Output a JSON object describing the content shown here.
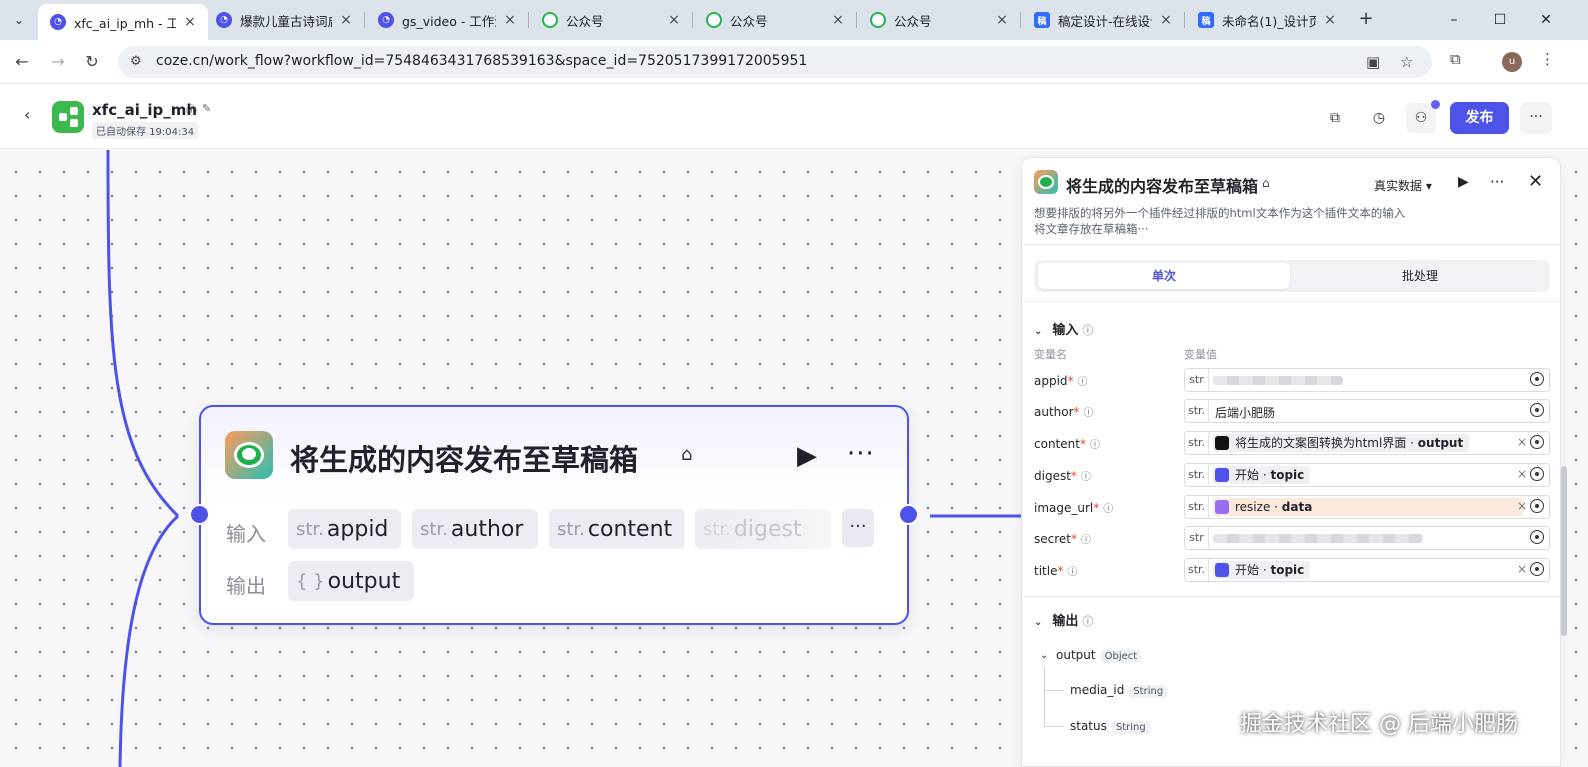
{
  "browser": {
    "tabs": [
      {
        "label": "xfc_ai_ip_mh - 工",
        "icon": "coze-icon",
        "active": true
      },
      {
        "label": "爆款儿童古诗词启",
        "icon": "coze-icon"
      },
      {
        "label": "gs_video - 工作流",
        "icon": "coze-icon"
      },
      {
        "label": "公众号",
        "icon": "wechat-icon"
      },
      {
        "label": "公众号",
        "icon": "wechat-icon"
      },
      {
        "label": "公众号",
        "icon": "wechat-icon"
      },
      {
        "label": "稿定设计-在线设计",
        "icon": "gaoding-icon"
      },
      {
        "label": "未命名(1)_设计页",
        "icon": "gaoding-icon"
      }
    ],
    "url": "coze.cn/work_flow?workflow_id=7548463431768539163&space_id=7520517399172005951",
    "profile_initial": "u"
  },
  "app": {
    "name": "xfc_ai_ip_mh",
    "save_status": "已自动保存 19:04:34",
    "publish_label": "发布",
    "accent": "#4d53e8"
  },
  "node": {
    "title": "将生成的内容发布至草稿箱",
    "input_label": "输入",
    "output_label": "输出",
    "inputs": [
      {
        "type": "str.",
        "name": "appid"
      },
      {
        "type": "str.",
        "name": "author"
      },
      {
        "type": "str.",
        "name": "content"
      },
      {
        "type": "str.",
        "name": "digest"
      }
    ],
    "output": {
      "type": "{ }",
      "name": "output"
    }
  },
  "panel": {
    "title": "将生成的内容发布至草稿箱",
    "mode_select": "真实数据",
    "description_line1": "想要排版的将另外一个插件经过排版的html文本作为这个插件文本的输入",
    "description_line2": "将文章存放在草稿箱···",
    "tabs": {
      "single": "单次",
      "batch": "批处理"
    },
    "input_section": "输入",
    "col_name": "变量名",
    "col_value": "变量值",
    "params": [
      {
        "name": "appid",
        "type": "str",
        "kind": "masked"
      },
      {
        "name": "author",
        "type": "str.",
        "kind": "text",
        "value": "后端小肥肠"
      },
      {
        "name": "content",
        "type": "str.",
        "kind": "ref",
        "source": "将生成的文案图转换为html界面",
        "field": "output",
        "icon_color": "black"
      },
      {
        "name": "digest",
        "type": "str.",
        "kind": "ref",
        "source": "开始",
        "field": "topic",
        "icon_color": "blue"
      },
      {
        "name": "image_url",
        "type": "str.",
        "kind": "ref",
        "source": "resize",
        "field": "data",
        "icon_color": "violet",
        "highlight": true
      },
      {
        "name": "secret",
        "type": "str",
        "kind": "masked"
      },
      {
        "name": "title",
        "type": "str.",
        "kind": "ref",
        "source": "开始",
        "field": "topic",
        "icon_color": "blue"
      }
    ],
    "output_section": "输出",
    "outputs": {
      "root": {
        "name": "output",
        "type": "Object"
      },
      "children": [
        {
          "name": "media_id",
          "type": "String"
        },
        {
          "name": "status",
          "type": "String"
        }
      ]
    }
  },
  "watermark": "掘金技术社区 @ 后端小肥肠"
}
